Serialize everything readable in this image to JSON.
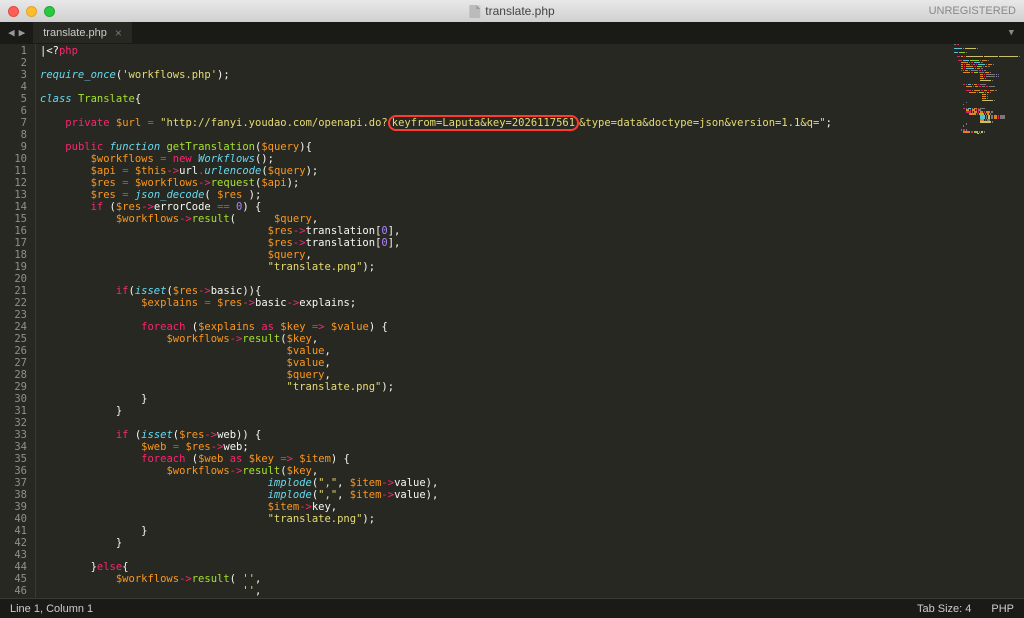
{
  "window": {
    "title": "translate.php",
    "registration": "UNREGISTERED"
  },
  "tabs": [
    {
      "label": "translate.php",
      "active": true
    }
  ],
  "status": {
    "position": "Line 1, Column 1",
    "tab_size": "Tab Size: 4",
    "language": "PHP"
  },
  "code": {
    "highlighted_fragment": "keyfrom=Laputa&key=2026117561",
    "lines": [
      {
        "n": 1,
        "tokens": [
          [
            "plain",
            "|<?"
          ],
          [
            "kw",
            "php"
          ]
        ]
      },
      {
        "n": 2,
        "tokens": []
      },
      {
        "n": 3,
        "tokens": [
          [
            "sup",
            "require_once"
          ],
          [
            "plain",
            "("
          ],
          [
            "str",
            "'workflows.php'"
          ],
          [
            "plain",
            ");"
          ]
        ]
      },
      {
        "n": 4,
        "tokens": []
      },
      {
        "n": 5,
        "tokens": [
          [
            "defkw",
            "class"
          ],
          [
            "plain",
            " "
          ],
          [
            "fn",
            "Translate"
          ],
          [
            "plain",
            "{"
          ]
        ]
      },
      {
        "n": 6,
        "tokens": []
      },
      {
        "n": 7,
        "tokens": [
          [
            "plain",
            "    "
          ],
          [
            "kw",
            "private"
          ],
          [
            "plain",
            " "
          ],
          [
            "var",
            "$url"
          ],
          [
            "plain",
            " "
          ],
          [
            "op",
            "="
          ],
          [
            "plain",
            " "
          ],
          [
            "str",
            "\"http://fanyi.youdao.com/openapi.do?"
          ],
          [
            "hl",
            "keyfrom=Laputa&key=2026117561"
          ],
          [
            "str",
            "&type=data&doctype=json&version=1.1&q=\""
          ],
          [
            "plain",
            ";"
          ]
        ]
      },
      {
        "n": 8,
        "tokens": []
      },
      {
        "n": 9,
        "tokens": [
          [
            "plain",
            "    "
          ],
          [
            "kw",
            "public"
          ],
          [
            "plain",
            " "
          ],
          [
            "defkw",
            "function"
          ],
          [
            "plain",
            " "
          ],
          [
            "fn",
            "getTranslation"
          ],
          [
            "plain",
            "("
          ],
          [
            "var",
            "$query"
          ],
          [
            "plain",
            "){"
          ]
        ]
      },
      {
        "n": 10,
        "tokens": [
          [
            "plain",
            "        "
          ],
          [
            "var",
            "$workflows"
          ],
          [
            "plain",
            " "
          ],
          [
            "op",
            "="
          ],
          [
            "plain",
            " "
          ],
          [
            "op",
            "new"
          ],
          [
            "plain",
            " "
          ],
          [
            "sup",
            "Workflows"
          ],
          [
            "plain",
            "();"
          ]
        ]
      },
      {
        "n": 11,
        "tokens": [
          [
            "plain",
            "        "
          ],
          [
            "var",
            "$api"
          ],
          [
            "plain",
            " "
          ],
          [
            "op",
            "="
          ],
          [
            "plain",
            " "
          ],
          [
            "var",
            "$this"
          ],
          [
            "op",
            "->"
          ],
          [
            "plain",
            "url"
          ],
          [
            "op",
            "."
          ],
          [
            "sup",
            "urlencode"
          ],
          [
            "plain",
            "("
          ],
          [
            "var",
            "$query"
          ],
          [
            "plain",
            ");"
          ]
        ]
      },
      {
        "n": 12,
        "tokens": [
          [
            "plain",
            "        "
          ],
          [
            "var",
            "$res"
          ],
          [
            "plain",
            " "
          ],
          [
            "op",
            "="
          ],
          [
            "plain",
            " "
          ],
          [
            "var",
            "$workflows"
          ],
          [
            "op",
            "->"
          ],
          [
            "fn",
            "request"
          ],
          [
            "plain",
            "("
          ],
          [
            "var",
            "$api"
          ],
          [
            "plain",
            ");"
          ]
        ]
      },
      {
        "n": 13,
        "tokens": [
          [
            "plain",
            "        "
          ],
          [
            "var",
            "$res"
          ],
          [
            "plain",
            " "
          ],
          [
            "op",
            "="
          ],
          [
            "plain",
            " "
          ],
          [
            "sup",
            "json_decode"
          ],
          [
            "plain",
            "( "
          ],
          [
            "var",
            "$res"
          ],
          [
            "plain",
            " );"
          ]
        ]
      },
      {
        "n": 14,
        "tokens": [
          [
            "plain",
            "        "
          ],
          [
            "kw",
            "if"
          ],
          [
            "plain",
            " ("
          ],
          [
            "var",
            "$res"
          ],
          [
            "op",
            "->"
          ],
          [
            "plain",
            "errorCode "
          ],
          [
            "op",
            "=="
          ],
          [
            "plain",
            " "
          ],
          [
            "num",
            "0"
          ],
          [
            "plain",
            ") {"
          ]
        ]
      },
      {
        "n": 15,
        "tokens": [
          [
            "plain",
            "            "
          ],
          [
            "var",
            "$workflows"
          ],
          [
            "op",
            "->"
          ],
          [
            "fn",
            "result"
          ],
          [
            "plain",
            "(      "
          ],
          [
            "var",
            "$query"
          ],
          [
            "plain",
            ","
          ]
        ]
      },
      {
        "n": 16,
        "tokens": [
          [
            "plain",
            "                                    "
          ],
          [
            "var",
            "$res"
          ],
          [
            "op",
            "->"
          ],
          [
            "plain",
            "translation["
          ],
          [
            "num",
            "0"
          ],
          [
            "plain",
            "],"
          ]
        ]
      },
      {
        "n": 17,
        "tokens": [
          [
            "plain",
            "                                    "
          ],
          [
            "var",
            "$res"
          ],
          [
            "op",
            "->"
          ],
          [
            "plain",
            "translation["
          ],
          [
            "num",
            "0"
          ],
          [
            "plain",
            "],"
          ]
        ]
      },
      {
        "n": 18,
        "tokens": [
          [
            "plain",
            "                                    "
          ],
          [
            "var",
            "$query"
          ],
          [
            "plain",
            ","
          ]
        ]
      },
      {
        "n": 19,
        "tokens": [
          [
            "plain",
            "                                    "
          ],
          [
            "str",
            "\"translate.png\""
          ],
          [
            "plain",
            ");"
          ]
        ]
      },
      {
        "n": 20,
        "tokens": []
      },
      {
        "n": 21,
        "tokens": [
          [
            "plain",
            "            "
          ],
          [
            "kw",
            "if"
          ],
          [
            "plain",
            "("
          ],
          [
            "sup",
            "isset"
          ],
          [
            "plain",
            "("
          ],
          [
            "var",
            "$res"
          ],
          [
            "op",
            "->"
          ],
          [
            "plain",
            "basic)){"
          ]
        ]
      },
      {
        "n": 22,
        "tokens": [
          [
            "plain",
            "                "
          ],
          [
            "var",
            "$explains"
          ],
          [
            "plain",
            " "
          ],
          [
            "op",
            "="
          ],
          [
            "plain",
            " "
          ],
          [
            "var",
            "$res"
          ],
          [
            "op",
            "->"
          ],
          [
            "plain",
            "basic"
          ],
          [
            "op",
            "->"
          ],
          [
            "plain",
            "explains;"
          ]
        ]
      },
      {
        "n": 23,
        "tokens": []
      },
      {
        "n": 24,
        "tokens": [
          [
            "plain",
            "                "
          ],
          [
            "kw",
            "foreach"
          ],
          [
            "plain",
            " ("
          ],
          [
            "var",
            "$explains"
          ],
          [
            "plain",
            " "
          ],
          [
            "kw",
            "as"
          ],
          [
            "plain",
            " "
          ],
          [
            "var",
            "$key"
          ],
          [
            "plain",
            " "
          ],
          [
            "op",
            "=>"
          ],
          [
            "plain",
            " "
          ],
          [
            "var",
            "$value"
          ],
          [
            "plain",
            ") {"
          ]
        ]
      },
      {
        "n": 25,
        "tokens": [
          [
            "plain",
            "                    "
          ],
          [
            "var",
            "$workflows"
          ],
          [
            "op",
            "->"
          ],
          [
            "fn",
            "result"
          ],
          [
            "plain",
            "("
          ],
          [
            "var",
            "$key"
          ],
          [
            "plain",
            ","
          ]
        ]
      },
      {
        "n": 26,
        "tokens": [
          [
            "plain",
            "                                       "
          ],
          [
            "var",
            "$value"
          ],
          [
            "plain",
            ","
          ]
        ]
      },
      {
        "n": 27,
        "tokens": [
          [
            "plain",
            "                                       "
          ],
          [
            "var",
            "$value"
          ],
          [
            "plain",
            ","
          ]
        ]
      },
      {
        "n": 28,
        "tokens": [
          [
            "plain",
            "                                       "
          ],
          [
            "var",
            "$query"
          ],
          [
            "plain",
            ","
          ]
        ]
      },
      {
        "n": 29,
        "tokens": [
          [
            "plain",
            "                                       "
          ],
          [
            "str",
            "\"translate.png\""
          ],
          [
            "plain",
            ");"
          ]
        ]
      },
      {
        "n": 30,
        "tokens": [
          [
            "plain",
            "                }"
          ]
        ]
      },
      {
        "n": 31,
        "tokens": [
          [
            "plain",
            "            }"
          ]
        ]
      },
      {
        "n": 32,
        "tokens": []
      },
      {
        "n": 33,
        "tokens": [
          [
            "plain",
            "            "
          ],
          [
            "kw",
            "if"
          ],
          [
            "plain",
            " ("
          ],
          [
            "sup",
            "isset"
          ],
          [
            "plain",
            "("
          ],
          [
            "var",
            "$res"
          ],
          [
            "op",
            "->"
          ],
          [
            "plain",
            "web)) {"
          ]
        ]
      },
      {
        "n": 34,
        "tokens": [
          [
            "plain",
            "                "
          ],
          [
            "var",
            "$web"
          ],
          [
            "plain",
            " "
          ],
          [
            "op",
            "="
          ],
          [
            "plain",
            " "
          ],
          [
            "var",
            "$res"
          ],
          [
            "op",
            "->"
          ],
          [
            "plain",
            "web;"
          ]
        ]
      },
      {
        "n": 35,
        "tokens": [
          [
            "plain",
            "                "
          ],
          [
            "kw",
            "foreach"
          ],
          [
            "plain",
            " ("
          ],
          [
            "var",
            "$web"
          ],
          [
            "plain",
            " "
          ],
          [
            "kw",
            "as"
          ],
          [
            "plain",
            " "
          ],
          [
            "var",
            "$key"
          ],
          [
            "plain",
            " "
          ],
          [
            "op",
            "=>"
          ],
          [
            "plain",
            " "
          ],
          [
            "var",
            "$item"
          ],
          [
            "plain",
            ") {"
          ]
        ]
      },
      {
        "n": 36,
        "tokens": [
          [
            "plain",
            "                    "
          ],
          [
            "var",
            "$workflows"
          ],
          [
            "op",
            "->"
          ],
          [
            "fn",
            "result"
          ],
          [
            "plain",
            "("
          ],
          [
            "var",
            "$key"
          ],
          [
            "plain",
            ","
          ]
        ]
      },
      {
        "n": 37,
        "tokens": [
          [
            "plain",
            "                                    "
          ],
          [
            "sup",
            "implode"
          ],
          [
            "plain",
            "("
          ],
          [
            "str",
            "\",\""
          ],
          [
            "plain",
            ", "
          ],
          [
            "var",
            "$item"
          ],
          [
            "op",
            "->"
          ],
          [
            "plain",
            "value),"
          ]
        ]
      },
      {
        "n": 38,
        "tokens": [
          [
            "plain",
            "                                    "
          ],
          [
            "sup",
            "implode"
          ],
          [
            "plain",
            "("
          ],
          [
            "str",
            "\",\""
          ],
          [
            "plain",
            ", "
          ],
          [
            "var",
            "$item"
          ],
          [
            "op",
            "->"
          ],
          [
            "plain",
            "value),"
          ]
        ]
      },
      {
        "n": 39,
        "tokens": [
          [
            "plain",
            "                                    "
          ],
          [
            "var",
            "$item"
          ],
          [
            "op",
            "->"
          ],
          [
            "plain",
            "key,"
          ]
        ]
      },
      {
        "n": 40,
        "tokens": [
          [
            "plain",
            "                                    "
          ],
          [
            "str",
            "\"translate.png\""
          ],
          [
            "plain",
            ");"
          ]
        ]
      },
      {
        "n": 41,
        "tokens": [
          [
            "plain",
            "                }"
          ]
        ]
      },
      {
        "n": 42,
        "tokens": [
          [
            "plain",
            "            }"
          ]
        ]
      },
      {
        "n": 43,
        "tokens": []
      },
      {
        "n": 44,
        "tokens": [
          [
            "plain",
            "        }"
          ],
          [
            "kw",
            "else"
          ],
          [
            "plain",
            "{"
          ]
        ]
      },
      {
        "n": 45,
        "tokens": [
          [
            "plain",
            "            "
          ],
          [
            "var",
            "$workflows"
          ],
          [
            "op",
            "->"
          ],
          [
            "fn",
            "result"
          ],
          [
            "plain",
            "( "
          ],
          [
            "str",
            "''"
          ],
          [
            "plain",
            ","
          ]
        ]
      },
      {
        "n": 46,
        "tokens": [
          [
            "plain",
            "                                "
          ],
          [
            "str",
            "''"
          ],
          [
            "plain",
            ","
          ]
        ]
      }
    ]
  }
}
